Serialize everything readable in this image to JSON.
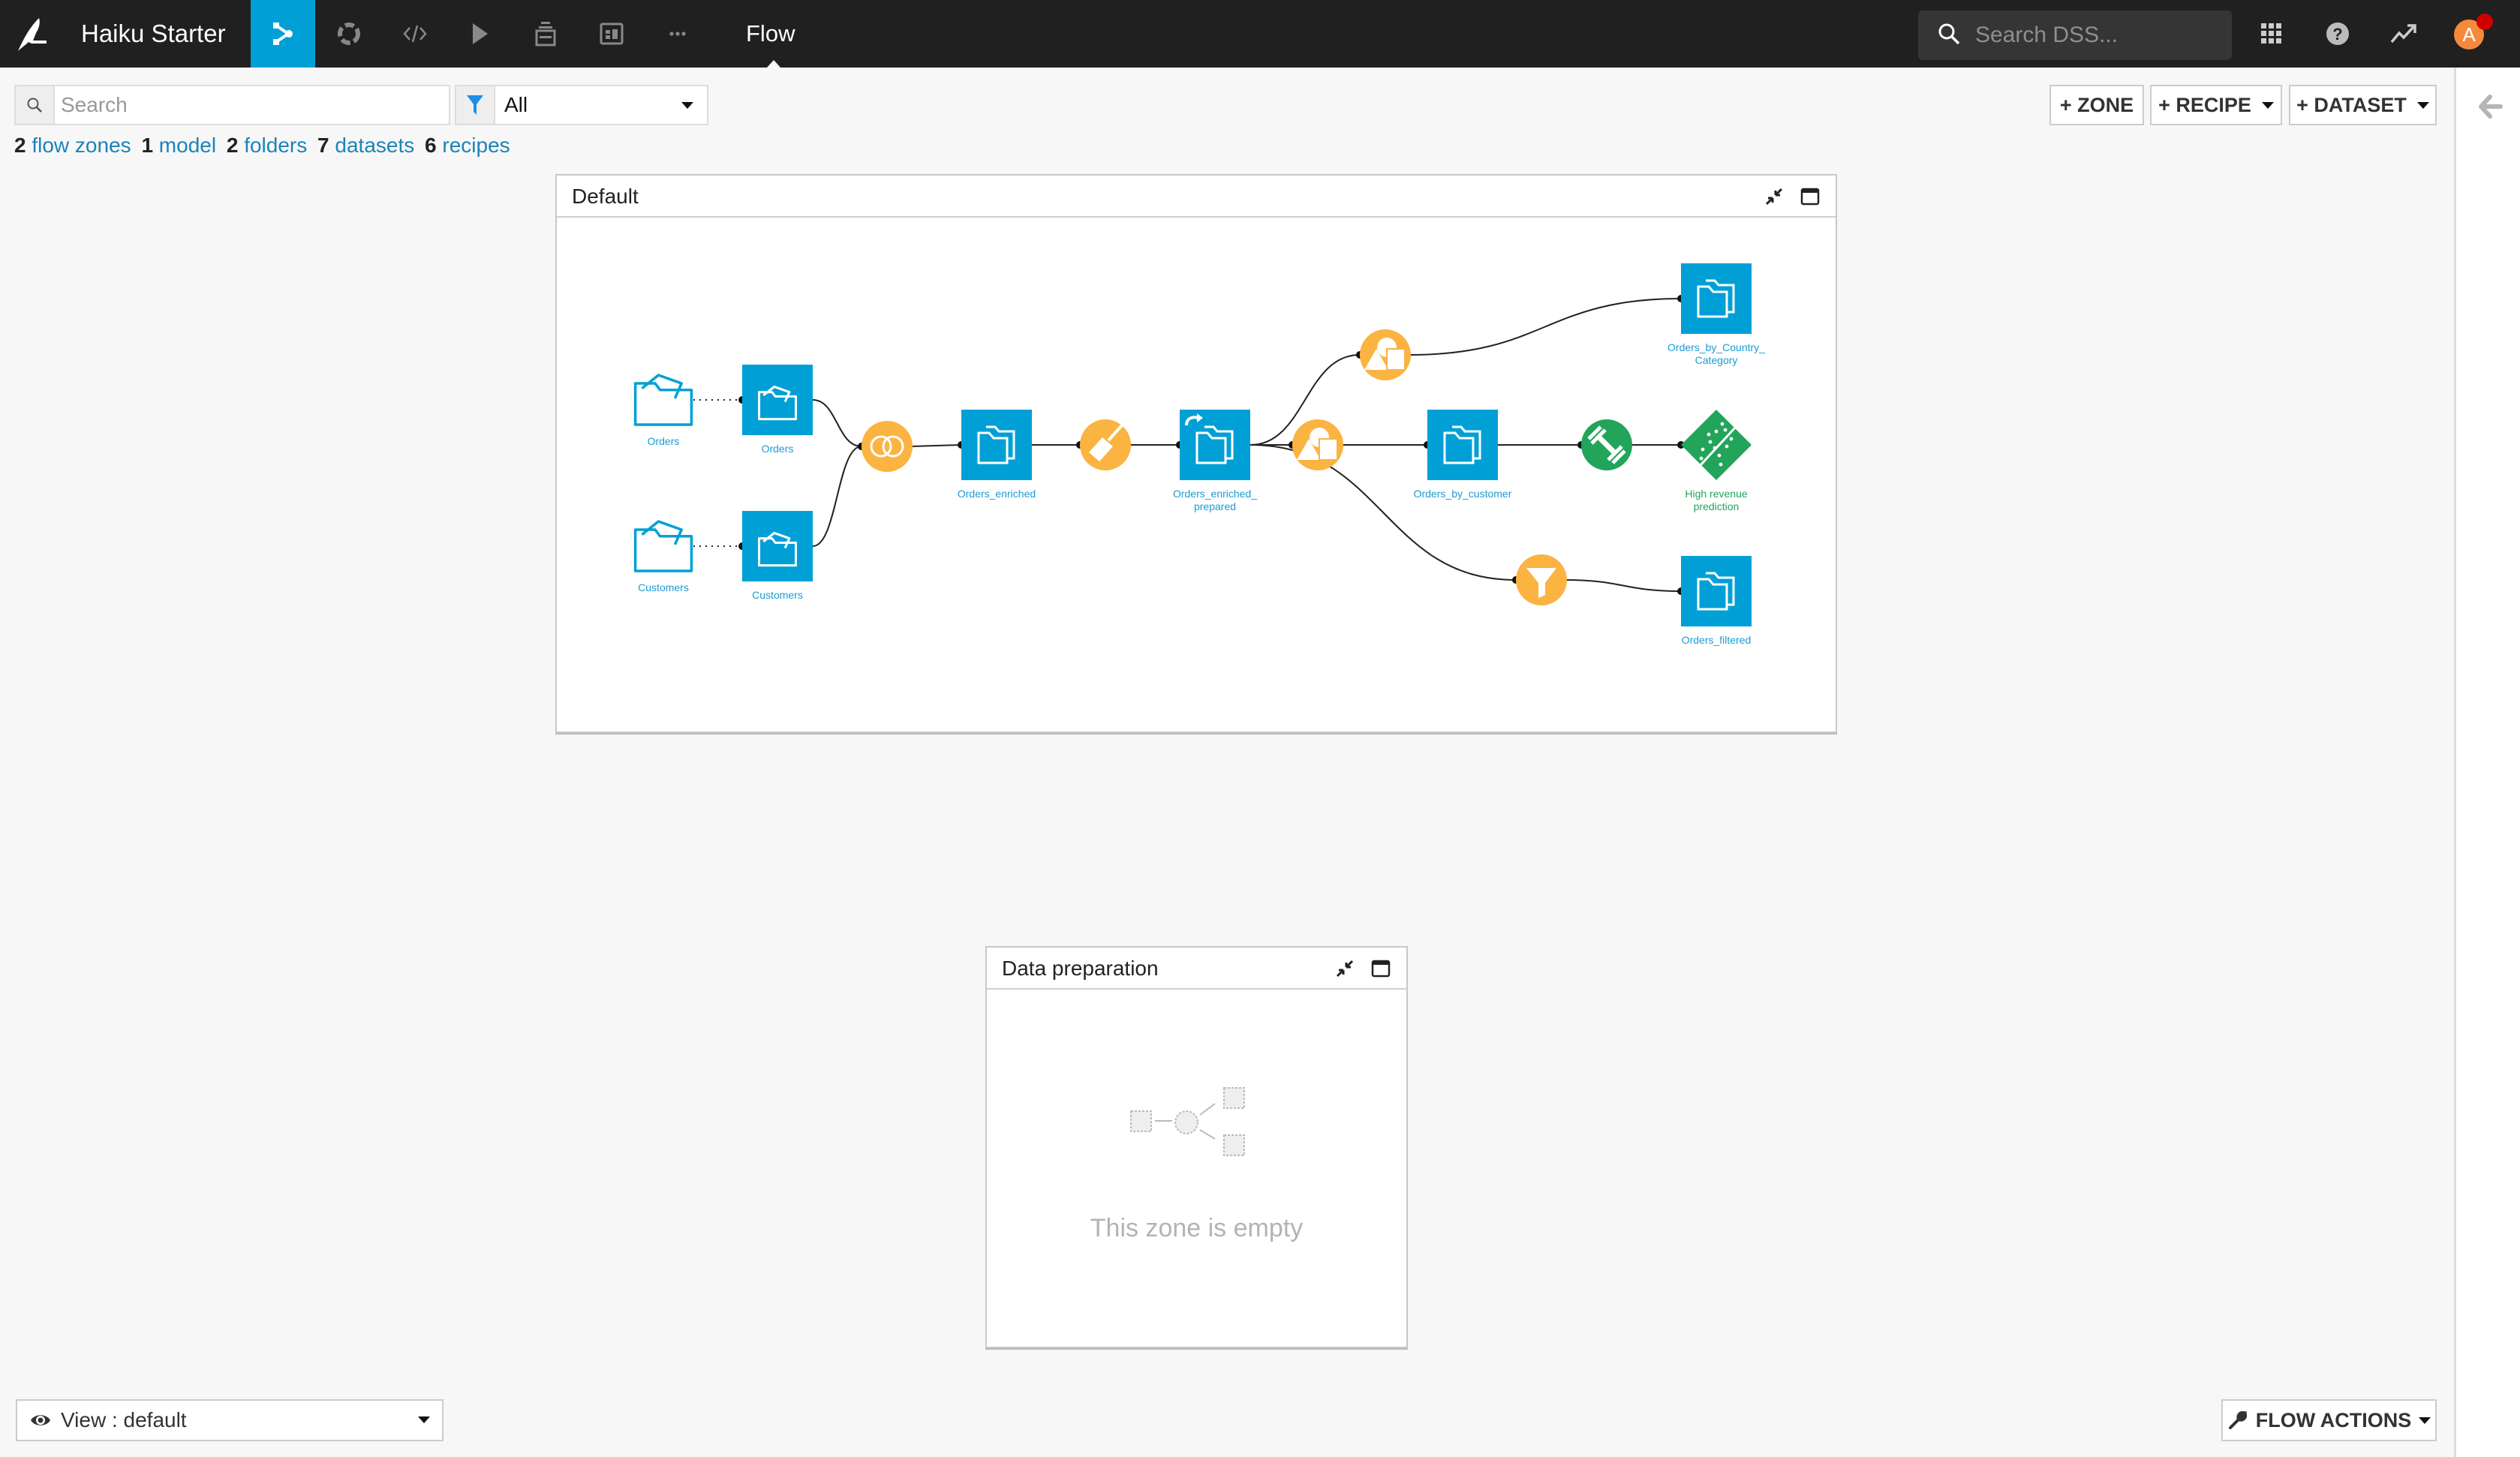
{
  "app": {
    "title": "Haiku Starter",
    "page": "Flow",
    "search_placeholder": "Search DSS...",
    "avatar_initial": "A",
    "colors": {
      "topbar": "#202020",
      "accent": "#00a0d6",
      "dataset": "#00a0d6",
      "recipe": "#fbb342",
      "ml": "#22a45a",
      "notification": "#ce0000",
      "avatar": "#f58a3c"
    }
  },
  "nav": [
    {
      "name": "flow",
      "icon": "flow-icon",
      "active": true
    },
    {
      "name": "lab",
      "icon": "lab-icon",
      "active": false
    },
    {
      "name": "code",
      "icon": "code-icon",
      "active": false
    },
    {
      "name": "jobs",
      "icon": "play-icon",
      "active": false
    },
    {
      "name": "wiki",
      "icon": "stack-icon",
      "active": false
    },
    {
      "name": "dashboards",
      "icon": "dashboard-icon",
      "active": false
    },
    {
      "name": "more",
      "icon": "ellipsis-icon",
      "active": false
    }
  ],
  "toolbar": {
    "search_placeholder": "Search",
    "search_value": "",
    "filter_value": "All",
    "zone_button": "+ ZONE",
    "recipe_button": "+ RECIPE",
    "dataset_button": "+ DATASET"
  },
  "counts": [
    {
      "n": "2",
      "label": "flow zones"
    },
    {
      "n": "1",
      "label": "model"
    },
    {
      "n": "2",
      "label": "folders"
    },
    {
      "n": "7",
      "label": "datasets"
    },
    {
      "n": "6",
      "label": "recipes"
    }
  ],
  "zones": {
    "default": {
      "title": "Default",
      "nodes": [
        {
          "id": "src_orders",
          "type": "folder",
          "label": "Orders"
        },
        {
          "id": "ds_orders",
          "type": "dataset-upload",
          "label": "Orders"
        },
        {
          "id": "src_customers",
          "type": "folder",
          "label": "Customers"
        },
        {
          "id": "ds_customers",
          "type": "dataset-upload",
          "label": "Customers"
        },
        {
          "id": "r_join",
          "type": "recipe-join",
          "label": ""
        },
        {
          "id": "ds_orders_enriched",
          "type": "dataset",
          "label": "Orders_enriched"
        },
        {
          "id": "r_prepare",
          "type": "recipe-prepare",
          "label": ""
        },
        {
          "id": "ds_orders_enriched_prepared",
          "type": "dataset-shared",
          "label": "Orders_enriched_\nprepared"
        },
        {
          "id": "r_group_country",
          "type": "recipe-group",
          "label": ""
        },
        {
          "id": "ds_orders_by_country",
          "type": "dataset",
          "label": "Orders_by_Country_\nCategory"
        },
        {
          "id": "r_group_customer",
          "type": "recipe-group",
          "label": ""
        },
        {
          "id": "ds_orders_by_customer",
          "type": "dataset",
          "label": "Orders_by_customer"
        },
        {
          "id": "r_train",
          "type": "recipe-train",
          "label": ""
        },
        {
          "id": "model_high_revenue",
          "type": "model",
          "label": "High revenue\nprediction"
        },
        {
          "id": "r_filter",
          "type": "recipe-filter",
          "label": ""
        },
        {
          "id": "ds_orders_filtered",
          "type": "dataset",
          "label": "Orders_filtered"
        }
      ],
      "edges": [
        [
          "src_orders",
          "ds_orders",
          "dotted"
        ],
        [
          "src_customers",
          "ds_customers",
          "dotted"
        ],
        [
          "ds_orders",
          "r_join",
          "solid"
        ],
        [
          "ds_customers",
          "r_join",
          "solid"
        ],
        [
          "r_join",
          "ds_orders_enriched",
          "solid"
        ],
        [
          "ds_orders_enriched",
          "r_prepare",
          "solid"
        ],
        [
          "r_prepare",
          "ds_orders_enriched_prepared",
          "solid"
        ],
        [
          "ds_orders_enriched_prepared",
          "r_group_country",
          "solid"
        ],
        [
          "r_group_country",
          "ds_orders_by_country",
          "solid"
        ],
        [
          "ds_orders_enriched_prepared",
          "r_group_customer",
          "solid"
        ],
        [
          "r_group_customer",
          "ds_orders_by_customer",
          "solid"
        ],
        [
          "ds_orders_by_customer",
          "r_train",
          "solid"
        ],
        [
          "r_train",
          "model_high_revenue",
          "solid"
        ],
        [
          "ds_orders_enriched_prepared",
          "r_filter",
          "solid"
        ],
        [
          "r_filter",
          "ds_orders_filtered",
          "solid"
        ]
      ]
    },
    "data_preparation": {
      "title": "Data preparation",
      "empty_text": "This zone is empty"
    }
  },
  "footer": {
    "view_label": "View : default",
    "flow_actions": "FLOW ACTIONS"
  }
}
